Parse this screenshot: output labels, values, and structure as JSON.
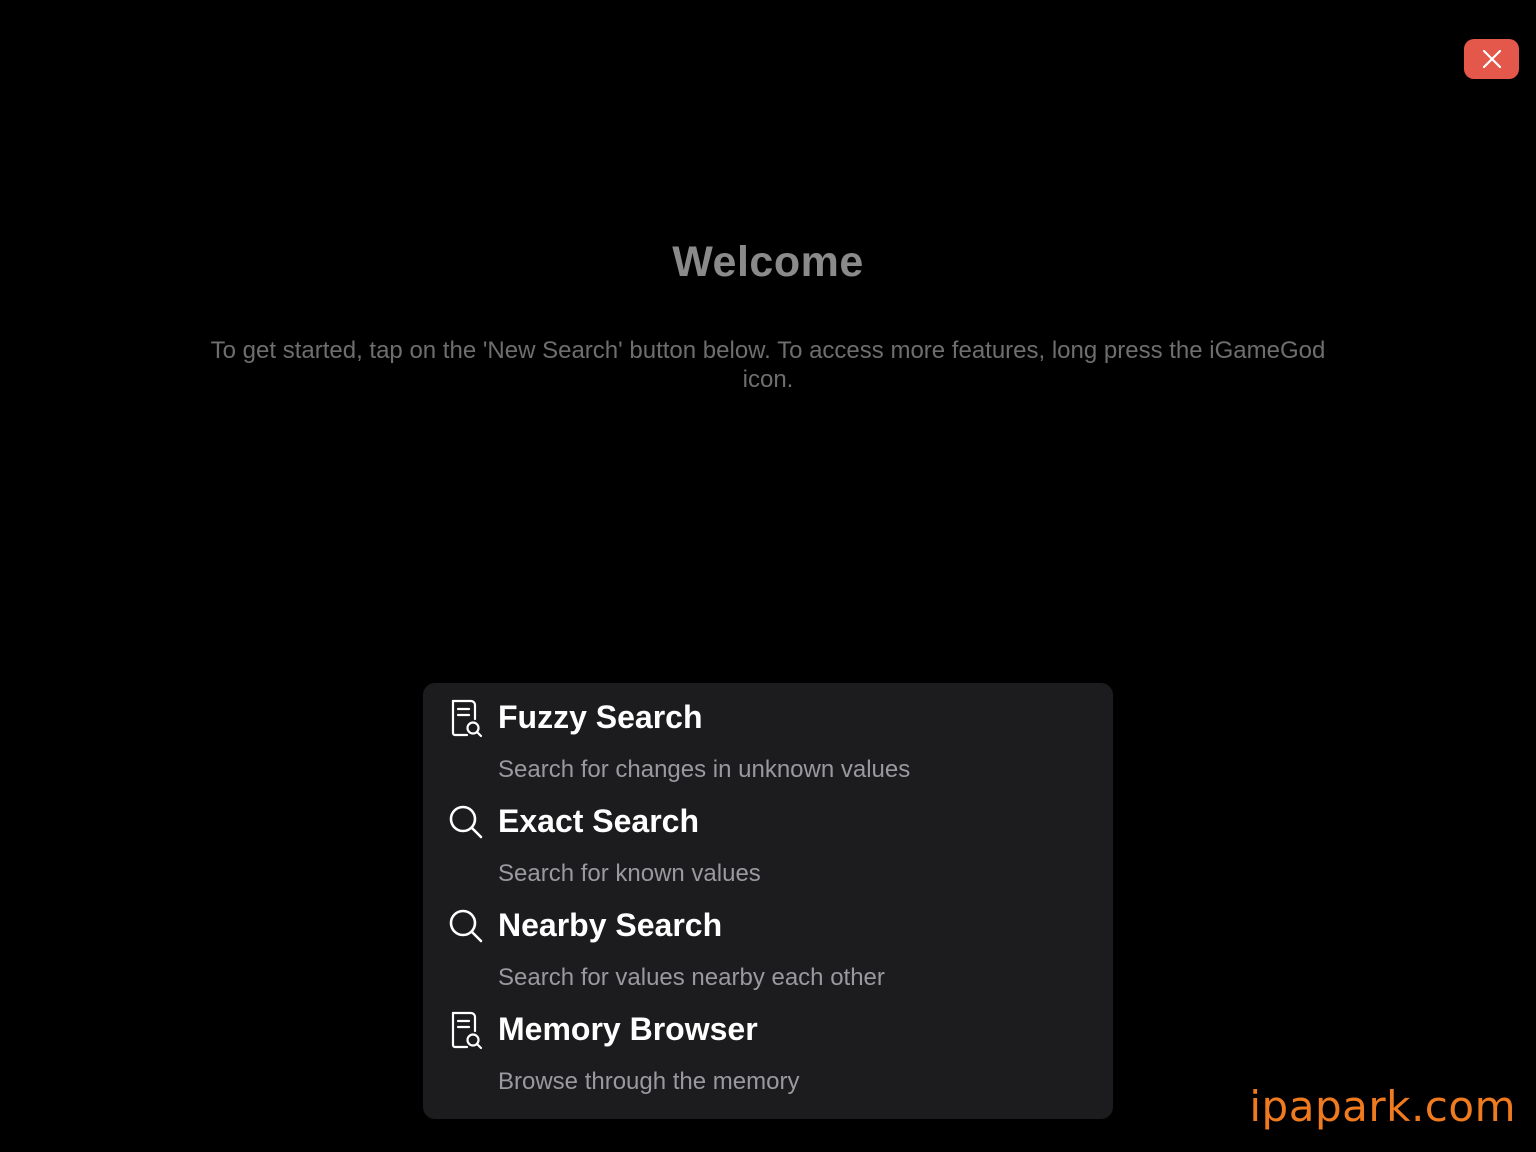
{
  "close_button": {
    "icon": "close-icon",
    "color": "#e4574b"
  },
  "welcome": {
    "title": "Welcome",
    "body": "To get started, tap on the 'New Search' button below. To access more features, long press the iGameGod icon."
  },
  "menu": {
    "items": [
      {
        "icon": "document-search-icon",
        "title": "Fuzzy Search",
        "subtitle": "Search for changes in unknown values"
      },
      {
        "icon": "search-icon",
        "title": "Exact Search",
        "subtitle": "Search for known values"
      },
      {
        "icon": "search-icon",
        "title": "Nearby Search",
        "subtitle": "Search for values nearby each other"
      },
      {
        "icon": "document-search-icon",
        "title": "Memory Browser",
        "subtitle": "Browse through the memory"
      }
    ]
  },
  "watermark": {
    "text": "ipapark.com",
    "color": "#f07a1e"
  }
}
